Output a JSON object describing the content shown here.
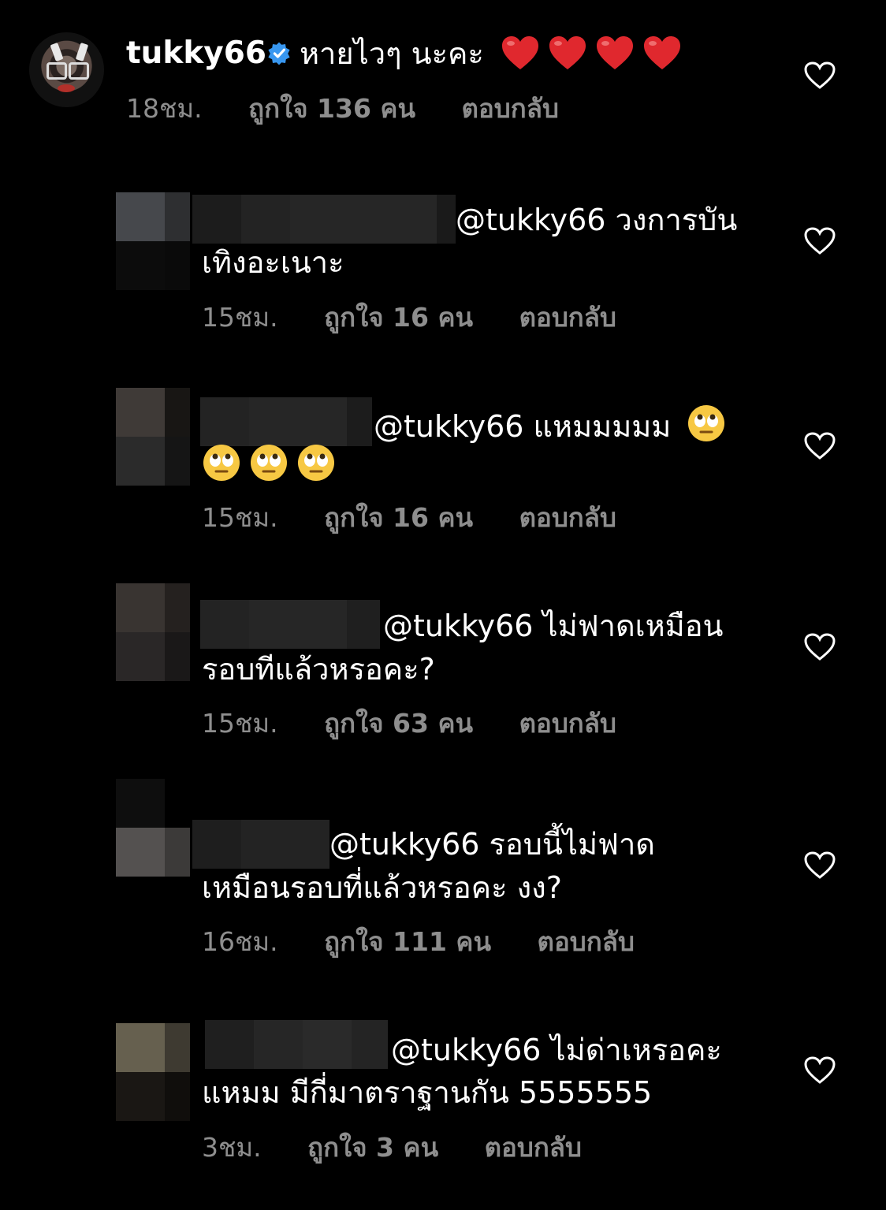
{
  "post": {
    "username": "tukky66",
    "verified": true,
    "text": "หายไวๆ นะคะ",
    "heart_count": 4,
    "time": "18ชม.",
    "likes": "ถูกใจ 136 คน",
    "reply": "ตอบกลับ"
  },
  "comments": [
    {
      "line1": "@tukky66 วงการบัน",
      "line2": "เทิงอะเนาะ",
      "time": "15ชม.",
      "likes": "ถูกใจ 16 คน",
      "reply": "ตอบกลับ"
    },
    {
      "line1": "@tukky66 แหมมมมม",
      "line2": "",
      "emoji_name": "face-with-rolling-eyes",
      "time": "15ชม.",
      "likes": "ถูกใจ 16 คน",
      "reply": "ตอบกลับ"
    },
    {
      "line1": "@tukky66 ไม่ฟาดเหมือน",
      "line2": "รอบทีแล้วหรอคะ?",
      "time": "15ชม.",
      "likes": "ถูกใจ 63 คน",
      "reply": "ตอบกลับ"
    },
    {
      "line1": "@tukky66 รอบนี้ไม่ฟาด",
      "line2": "เหมือนรอบที่แล้วหรอคะ งง?",
      "time": "16ชม.",
      "likes": "ถูกใจ 111 คน",
      "reply": "ตอบกลับ"
    },
    {
      "line1": "@tukky66 ไม่ด่าเหรอคะ",
      "line2": "แหมม มีกี่มาตราฐานกัน 5555555",
      "time": "3ชม.",
      "likes": "ถูกใจ 3 คน",
      "reply": "ตอบกลับ"
    }
  ],
  "colors": {
    "background": "#000000",
    "meta": "#8e8e8e",
    "verified": "#3897f0",
    "heart": "#e0282e"
  },
  "icons": [
    "heart-outline-icon",
    "verified-badge-icon",
    "red-heart-emoji",
    "face-with-rolling-eyes-emoji"
  ]
}
